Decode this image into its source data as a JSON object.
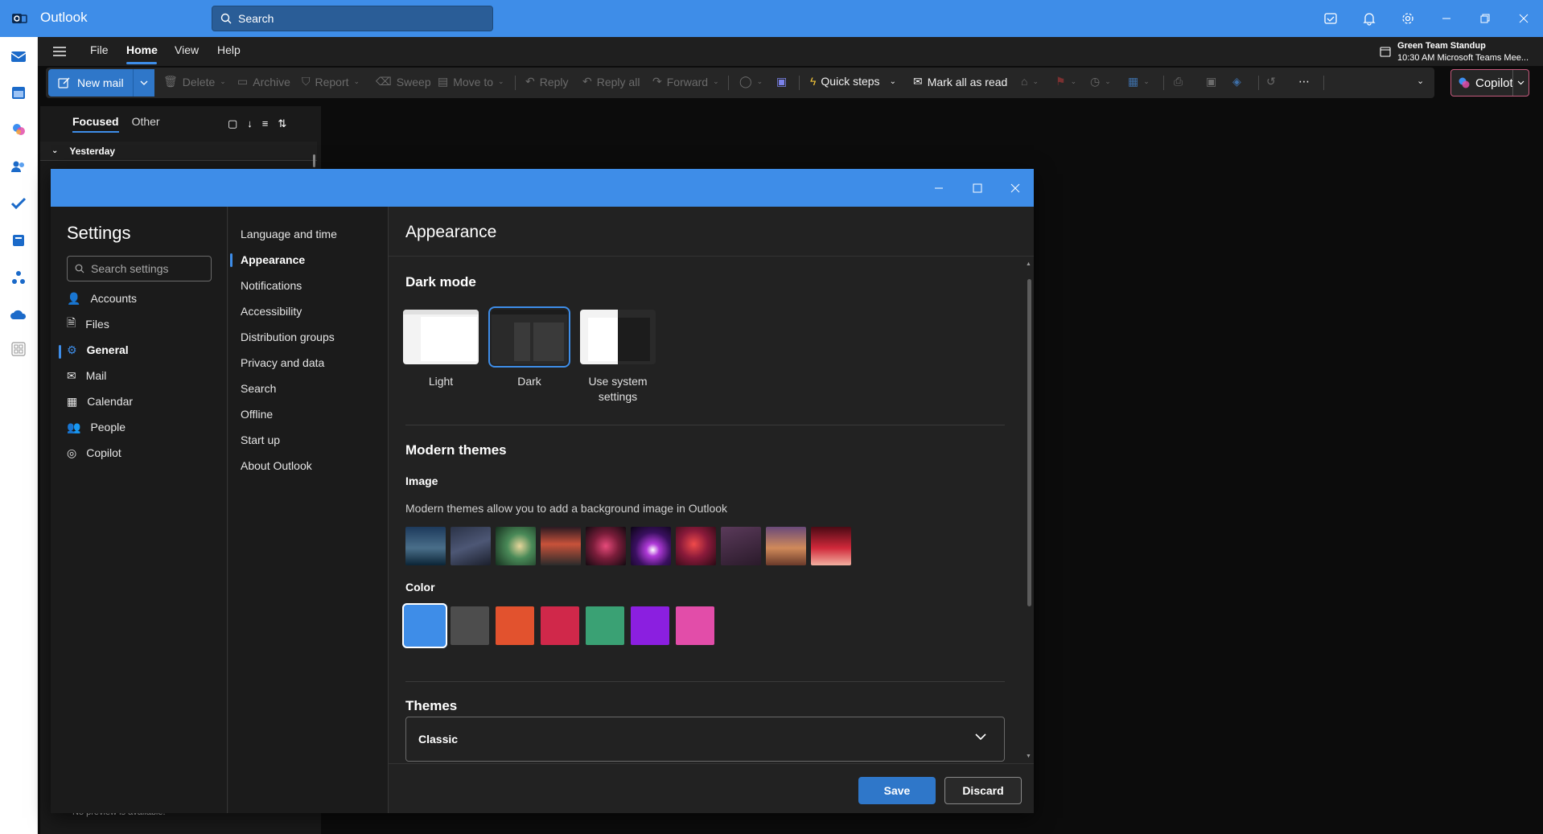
{
  "app": {
    "title": "Outlook"
  },
  "search": {
    "label": "Search"
  },
  "menu": {
    "file": "File",
    "home": "Home",
    "view": "View",
    "help": "Help"
  },
  "meeting": {
    "title": "Green Team Standup",
    "detail": "10:30 AM Microsoft Teams Mee..."
  },
  "ribbon": {
    "new_mail": "New mail",
    "delete": "Delete",
    "archive": "Archive",
    "report": "Report",
    "sweep": "Sweep",
    "move_to": "Move to",
    "reply": "Reply",
    "reply_all": "Reply all",
    "forward": "Forward",
    "quick_steps": "Quick steps",
    "mark_all_read": "Mark all as read",
    "copilot": "Copilot"
  },
  "mail_list": {
    "tab_focused": "Focused",
    "tab_other": "Other",
    "group": "Yesterday",
    "no_preview": "No preview is available."
  },
  "settings": {
    "title": "Settings",
    "search_placeholder": "Search settings",
    "categories": [
      {
        "label": "Accounts"
      },
      {
        "label": "Files"
      },
      {
        "label": "General"
      },
      {
        "label": "Mail"
      },
      {
        "label": "Calendar"
      },
      {
        "label": "People"
      },
      {
        "label": "Copilot"
      }
    ],
    "subcategories": [
      {
        "label": "Language and time"
      },
      {
        "label": "Appearance"
      },
      {
        "label": "Notifications"
      },
      {
        "label": "Accessibility"
      },
      {
        "label": "Distribution groups"
      },
      {
        "label": "Privacy and data"
      },
      {
        "label": "Search"
      },
      {
        "label": "Offline"
      },
      {
        "label": "Start up"
      },
      {
        "label": "About Outlook"
      }
    ]
  },
  "appearance": {
    "title": "Appearance",
    "dark_mode": {
      "heading": "Dark mode",
      "light": "Light",
      "dark": "Dark",
      "system_line1": "Use system",
      "system_line2": "settings",
      "selected": "Dark"
    },
    "modern_themes": {
      "heading": "Modern themes",
      "image_heading": "Image",
      "image_desc": "Modern themes allow you to add a background image in Outlook",
      "color_heading": "Color"
    },
    "swatches": [
      "#3e8de8",
      "#4d4d4d",
      "#e2522e",
      "#d0284a",
      "#3aa174",
      "#8b1fe0",
      "#e24da9"
    ],
    "themes": {
      "heading": "Themes",
      "value": "Classic"
    },
    "save": "Save",
    "discard": "Discard"
  }
}
